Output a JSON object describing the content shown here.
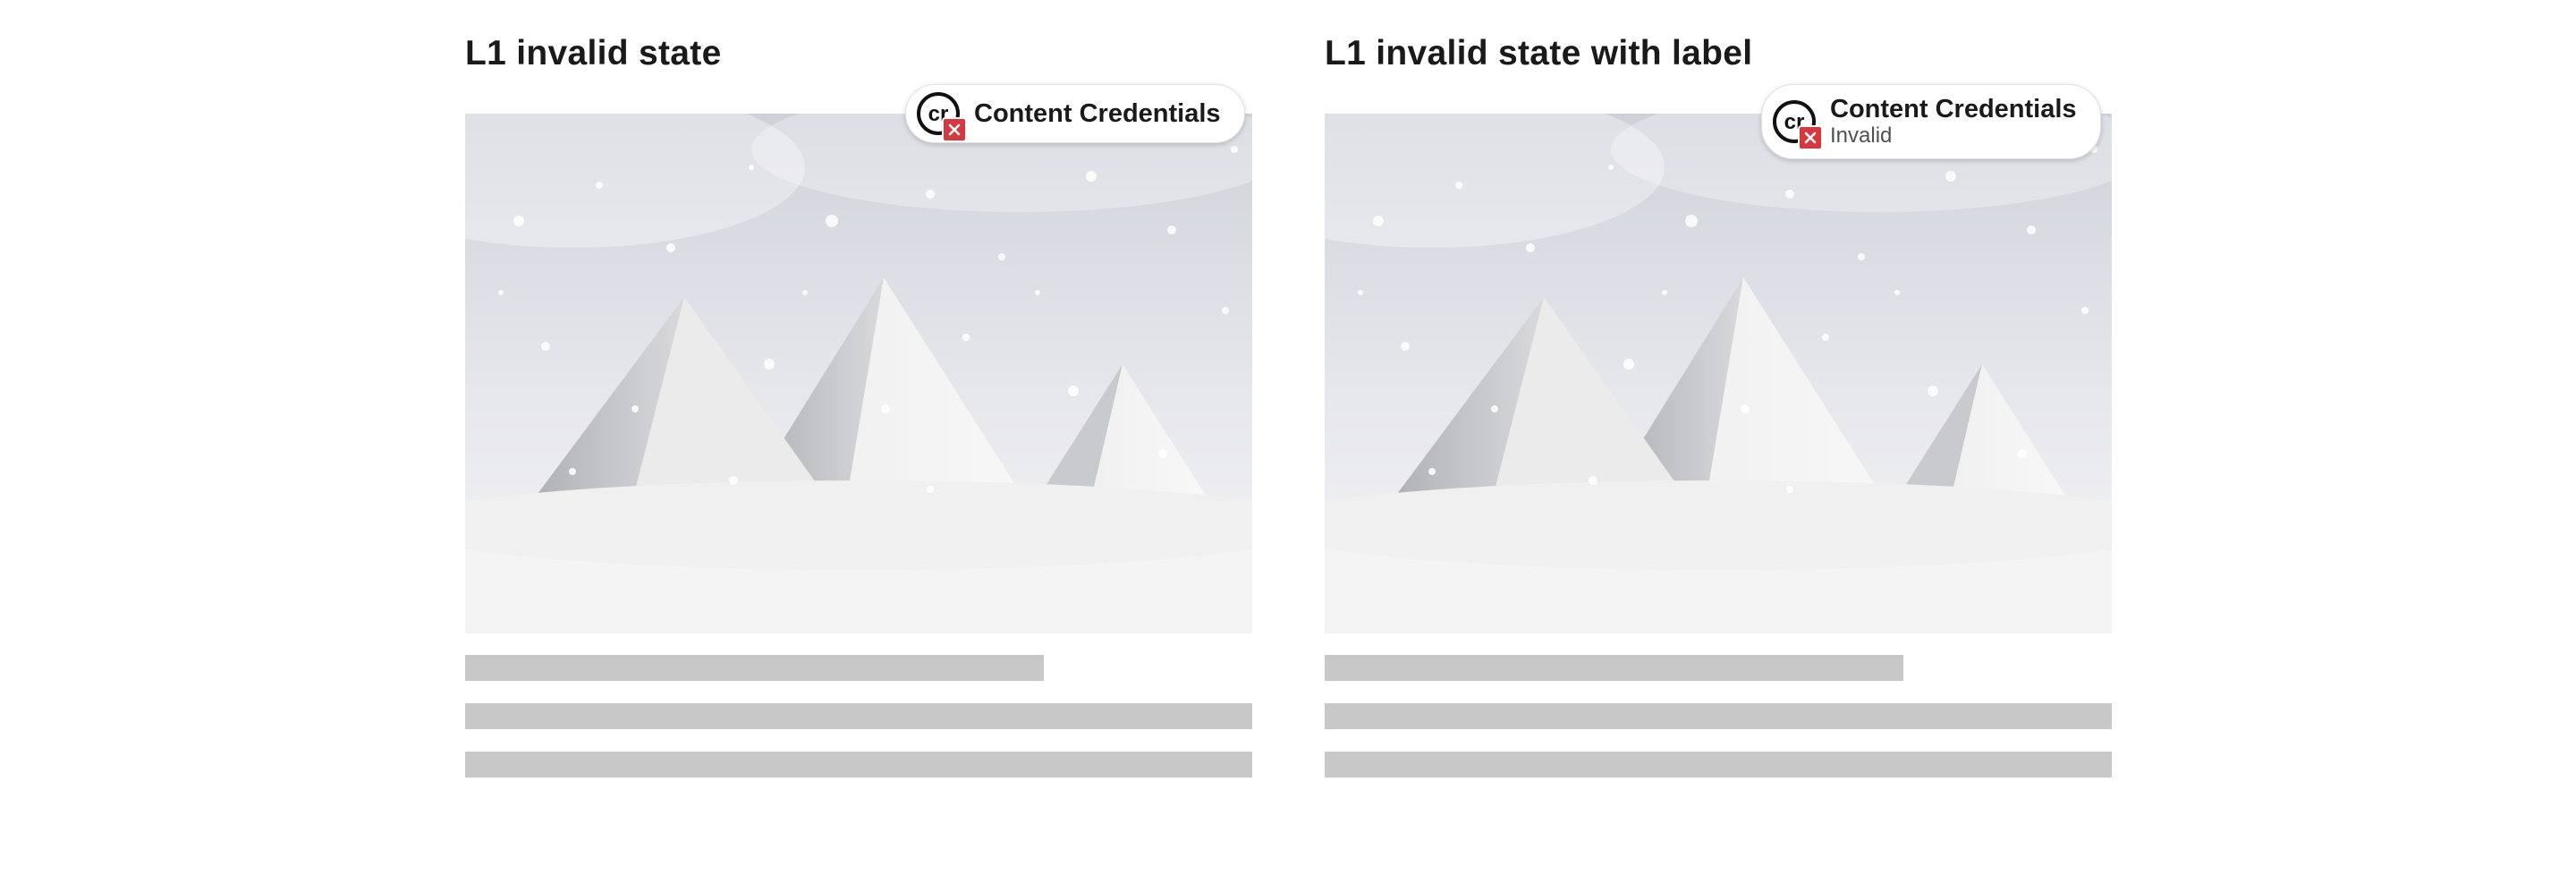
{
  "examples": [
    {
      "title": "L1 invalid state",
      "badge": {
        "label": "Content Credentials",
        "status": ""
      }
    },
    {
      "title": "L1 invalid state with label",
      "badge": {
        "label": "Content Credentials",
        "status": "Invalid"
      }
    }
  ],
  "icons": {
    "credential": "content-credentials-cr-icon",
    "error": "error-x-icon"
  },
  "colors": {
    "error": "#d7373f",
    "placeholder": "#c8c8c8",
    "title": "#1a1a1a"
  }
}
